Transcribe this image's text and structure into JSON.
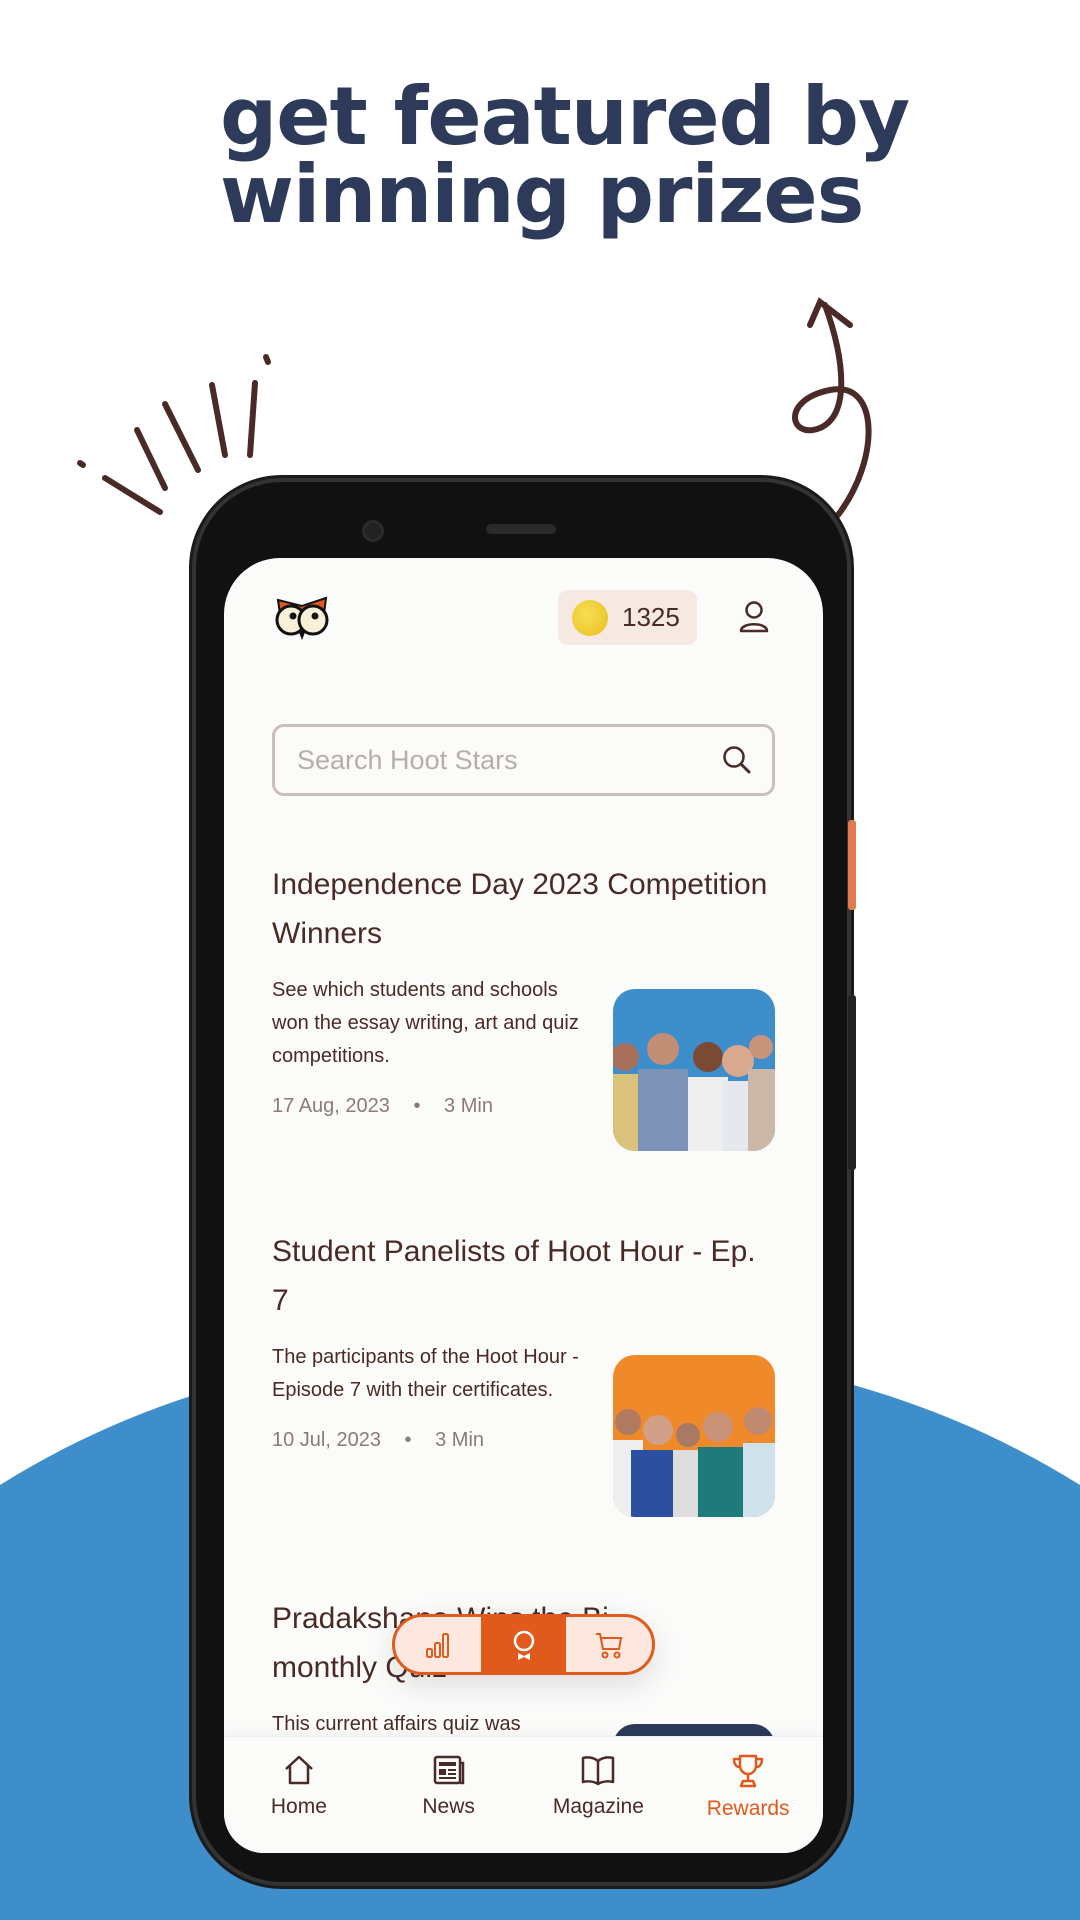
{
  "headline": [
    "get featured by",
    "winning prizes"
  ],
  "colors": {
    "accent": "#e05a1c",
    "navy": "#2d3a5a",
    "blue": "#3e8ecb",
    "text": "#4a2a26"
  },
  "header": {
    "logo": "owl-logo",
    "coins": "1325",
    "profile_icon": "user-icon"
  },
  "search": {
    "placeholder": "Search Hoot Stars",
    "value": ""
  },
  "articles": [
    {
      "title": "Independence Day 2023 Competition Winners",
      "description": "See which students and schools won the essay writing, art and quiz competitions.",
      "date": "17 Aug, 2023",
      "read_time": "3 Min"
    },
    {
      "title": "Student Panelists of Hoot Hour - Ep. 7",
      "description": "The participants of the Hoot Hour - Episode 7 with their certificates.",
      "date": "10 Jul, 2023",
      "read_time": "3 Min"
    },
    {
      "title": "Pradakshana Wins the Bi-monthly Quiz",
      "description": "This current affairs quiz was"
    }
  ],
  "meta_separator": "•",
  "fab": {
    "items": [
      "leaderboard",
      "hoot-stars",
      "store"
    ],
    "active": "hoot-stars"
  },
  "bottom_nav": {
    "items": [
      {
        "label": "Home",
        "icon": "home-icon"
      },
      {
        "label": "News",
        "icon": "newspaper-icon"
      },
      {
        "label": "Magazine",
        "icon": "book-icon"
      },
      {
        "label": "Rewards",
        "icon": "trophy-icon"
      }
    ],
    "active": "Rewards"
  }
}
